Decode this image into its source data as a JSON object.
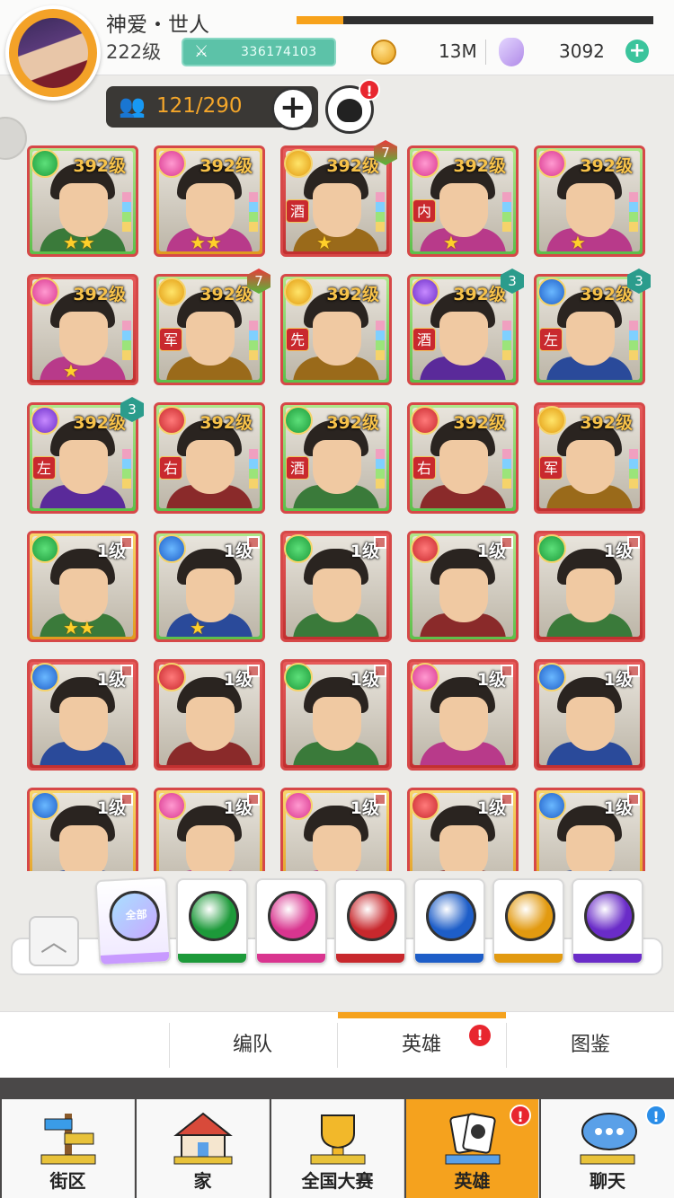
{
  "player": {
    "name": "神爱・世人",
    "level": "222级",
    "id": "336174103",
    "exp_fraction": 0.13
  },
  "currency": {
    "coins": "13M",
    "gems": "3092"
  },
  "roster": {
    "count": "121/290",
    "recruit_alert": "!"
  },
  "heroes": [
    {
      "level": "392级",
      "elem": "green",
      "frame": "green",
      "stars": "★★",
      "rank": ""
    },
    {
      "level": "392级",
      "elem": "pink",
      "frame": "gold",
      "stars": "★★",
      "rank": ""
    },
    {
      "level": "392级",
      "elem": "gold",
      "frame": "red",
      "stars": "★",
      "rank": "酒",
      "badge": "7"
    },
    {
      "level": "392级",
      "elem": "pink",
      "frame": "green",
      "stars": "★",
      "rank": "内"
    },
    {
      "level": "392级",
      "elem": "pink",
      "frame": "green",
      "stars": "★",
      "rank": ""
    },
    {
      "level": "392级",
      "elem": "pink",
      "frame": "red",
      "stars": "★",
      "rank": ""
    },
    {
      "level": "392级",
      "elem": "gold",
      "frame": "green",
      "stars": "",
      "rank": "军",
      "badge": "7"
    },
    {
      "level": "392级",
      "elem": "gold",
      "frame": "green",
      "stars": "",
      "rank": "先"
    },
    {
      "level": "392级",
      "elem": "purple",
      "frame": "green",
      "stars": "",
      "rank": "酒",
      "badge": "3"
    },
    {
      "level": "392级",
      "elem": "blue",
      "frame": "green",
      "stars": "",
      "rank": "左",
      "badge": "3"
    },
    {
      "level": "392级",
      "elem": "purple",
      "frame": "green",
      "stars": "",
      "rank": "左",
      "badge": "3"
    },
    {
      "level": "392级",
      "elem": "red",
      "frame": "green",
      "stars": "",
      "rank": "右"
    },
    {
      "level": "392级",
      "elem": "green",
      "frame": "green",
      "stars": "",
      "rank": "酒"
    },
    {
      "level": "392级",
      "elem": "red",
      "frame": "green",
      "stars": "",
      "rank": "右"
    },
    {
      "level": "392级",
      "elem": "gold",
      "frame": "red",
      "stars": "",
      "rank": "军"
    },
    {
      "level": "1级",
      "elem": "green",
      "frame": "gold",
      "stars": "★★",
      "rank": ""
    },
    {
      "level": "1级",
      "elem": "blue",
      "frame": "green",
      "stars": "★",
      "rank": ""
    },
    {
      "level": "1级",
      "elem": "green",
      "frame": "red",
      "stars": "",
      "rank": ""
    },
    {
      "level": "1级",
      "elem": "red",
      "frame": "green",
      "stars": "",
      "rank": ""
    },
    {
      "level": "1级",
      "elem": "green",
      "frame": "red",
      "stars": "",
      "rank": ""
    },
    {
      "level": "1级",
      "elem": "blue",
      "frame": "red",
      "stars": "",
      "rank": ""
    },
    {
      "level": "1级",
      "elem": "red",
      "frame": "red",
      "stars": "",
      "rank": ""
    },
    {
      "level": "1级",
      "elem": "green",
      "frame": "red",
      "stars": "",
      "rank": ""
    },
    {
      "level": "1级",
      "elem": "pink",
      "frame": "red",
      "stars": "",
      "rank": ""
    },
    {
      "level": "1级",
      "elem": "blue",
      "frame": "red",
      "stars": "",
      "rank": ""
    },
    {
      "level": "1级",
      "elem": "blue",
      "frame": "gold",
      "stars": "",
      "rank": ""
    },
    {
      "level": "1级",
      "elem": "pink",
      "frame": "gold",
      "stars": "",
      "rank": ""
    },
    {
      "level": "1级",
      "elem": "pink",
      "frame": "gold",
      "stars": "",
      "rank": ""
    },
    {
      "level": "1级",
      "elem": "red",
      "frame": "gold",
      "stars": "",
      "rank": ""
    },
    {
      "level": "1级",
      "elem": "blue",
      "frame": "gold",
      "stars": "",
      "rank": ""
    }
  ],
  "filters": {
    "all_label": "全部",
    "tabs": [
      {
        "icon": "all-icon",
        "color": "#c89aff"
      },
      {
        "icon": "spade-icon",
        "color": "#1d9a3a"
      },
      {
        "icon": "heart-icon",
        "color": "#d9358f"
      },
      {
        "icon": "club-icon",
        "color": "#c8282d"
      },
      {
        "icon": "diamond-icon",
        "color": "#1e5ec8"
      },
      {
        "icon": "sun-icon",
        "color": "#e29a10"
      },
      {
        "icon": "moon-icon",
        "color": "#6a2cc8"
      }
    ]
  },
  "subnav": {
    "formation": "编队",
    "heroes": "英雄",
    "codex": "图鉴",
    "alert": "!"
  },
  "bottomnav": {
    "district": "街区",
    "home": "家",
    "national": "全国大赛",
    "heroes": "英雄",
    "chat": "聊天",
    "heroes_alert": "!",
    "chat_alert": "!"
  },
  "colors": {
    "accent": "#f5a21e",
    "alert": "#e8262f",
    "teal": "#3bc49c"
  }
}
